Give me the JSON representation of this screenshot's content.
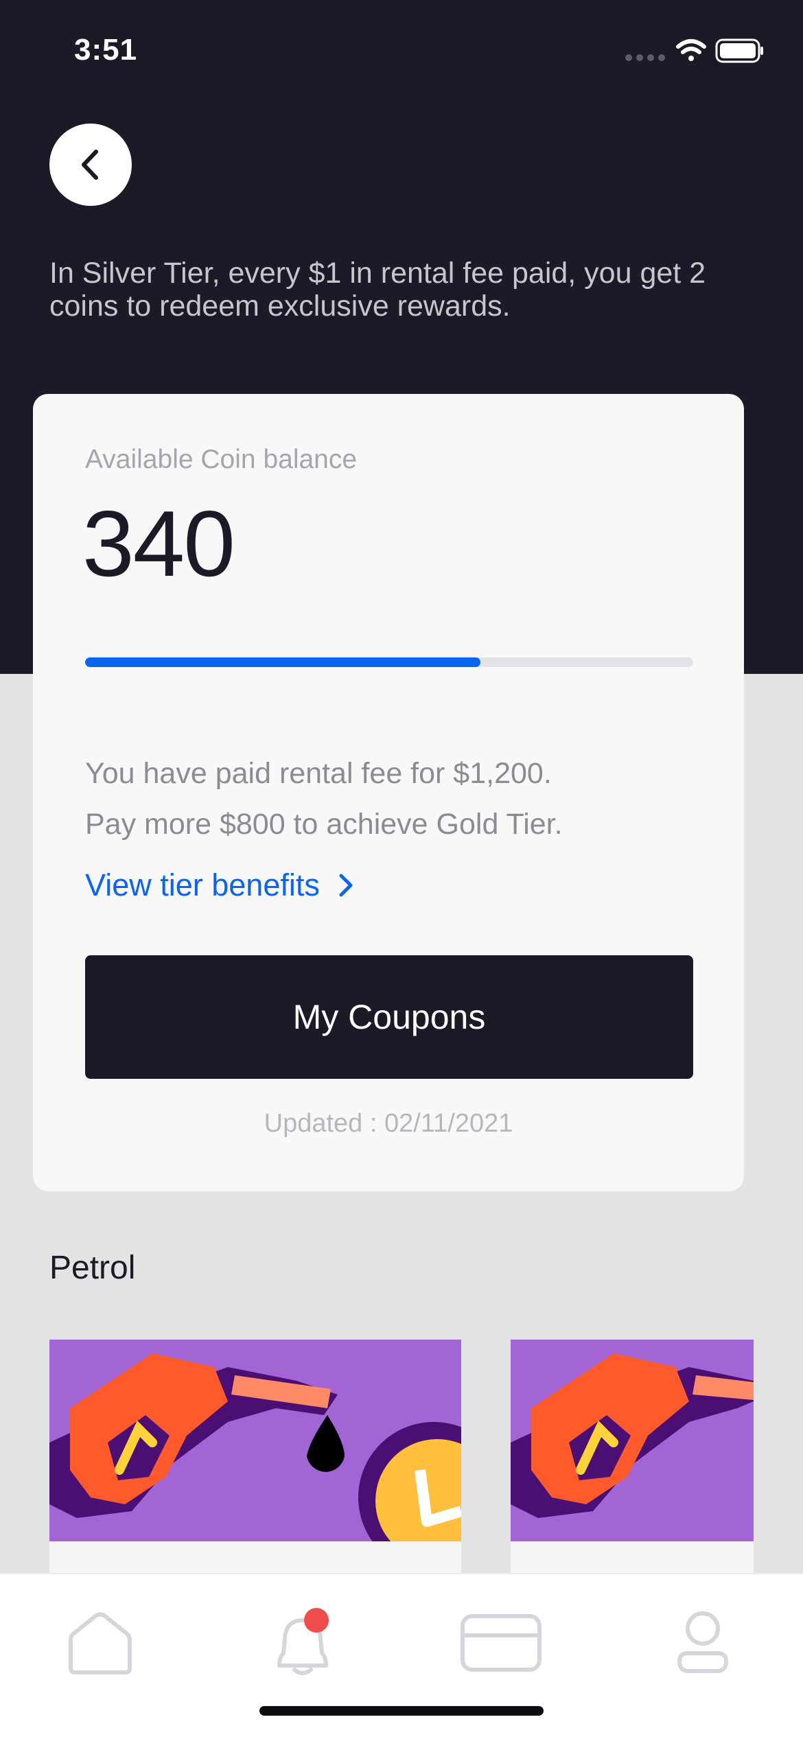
{
  "status_bar": {
    "time": "3:51"
  },
  "header": {
    "tier_description": "In Silver Tier, every $1 in rental fee paid, you get 2 coins to redeem exclusive rewards."
  },
  "coin_card": {
    "balance_label": "Available Coin balance",
    "balance_value": "340",
    "progress_fraction": 0.65,
    "paid_line_1": "You have paid rental fee for $1,200.",
    "paid_line_2": "Pay more $800 to achieve Gold Tier.",
    "tier_link_label": "View tier benefits",
    "coupons_button_label": "My Coupons",
    "updated_text": "Updated : 02/11/2021"
  },
  "petrol_section": {
    "title": "Petrol"
  },
  "tab_bar": {
    "items": [
      {
        "icon": "home-icon"
      },
      {
        "icon": "bell-icon",
        "badge": true
      },
      {
        "icon": "card-icon"
      },
      {
        "icon": "profile-icon"
      }
    ]
  },
  "colors": {
    "dark": "#1b1a27",
    "accent_blue": "#0a64f0",
    "promo_purple": "#a365d6",
    "badge_red": "#f04c4c"
  }
}
